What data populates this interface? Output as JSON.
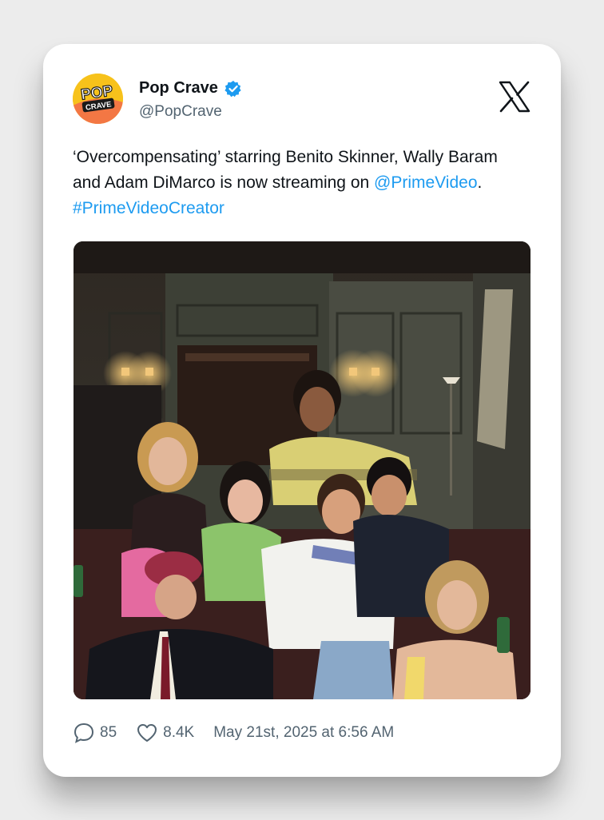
{
  "account": {
    "name": "Pop Crave",
    "handle": "@PopCrave",
    "avatar_text_top": "POP",
    "avatar_text_bottom": "CRAVE"
  },
  "tweet": {
    "text_main": "‘Overcompensating’ starring Benito Skinner, Wally Baram and Adam DiMarco is now streaming on",
    "mention": "@PrimeVideo",
    "separator": ". ",
    "hashtag": "#PrimeVideoCreator"
  },
  "stats": {
    "replies": "85",
    "likes": "8.4K",
    "timestamp": "May 21st, 2025 at 6:56 AM"
  },
  "icons": {
    "verified": "verified-badge-icon",
    "platform": "x-logo-icon",
    "reply": "reply-bubble-icon",
    "like": "heart-icon"
  },
  "colors": {
    "link": "#1d9bf0",
    "verified": "#1d9bf0",
    "avatar_bg": "#f5c518",
    "avatar_accent": "#f0544f"
  }
}
